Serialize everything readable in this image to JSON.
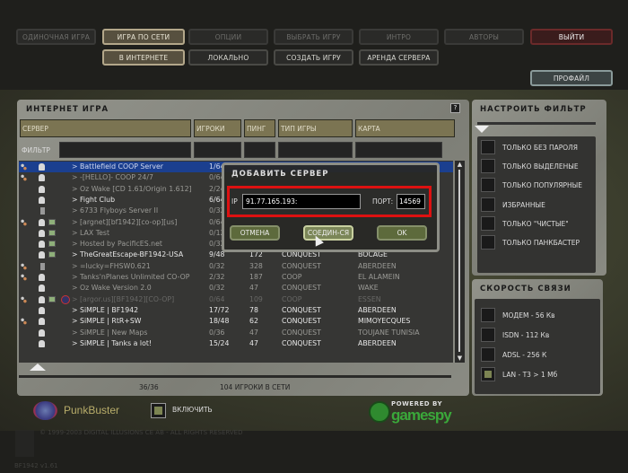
{
  "nav": {
    "main": [
      "ОДИНОЧНАЯ ИГРА",
      "ИГРА ПО СЕТИ",
      "ОПЦИИ",
      "ВЫБРАТЬ ИГРУ",
      "ИНТРО",
      "АВТОРЫ",
      "ВЫЙТИ"
    ],
    "sub": [
      "В ИНТЕРНЕТЕ",
      "ЛОКАЛЬНО",
      "СОЗДАТЬ ИГРУ",
      "АРЕНДА СЕРВЕРА"
    ],
    "profile": "ПРОФАЙЛ"
  },
  "browser": {
    "title": "ИНТЕРНЕТ ИГРА",
    "help": "?",
    "columns": [
      "СЕРВЕР",
      "ИГРОКИ",
      "ПИНГ",
      "ТИП ИГРЫ",
      "КАРТА"
    ],
    "filter_label": "ФИЛЬТР",
    "rows": [
      {
        "name": "> Battlefield COOP Server",
        "players": "1/64",
        "ping": "",
        "type": "",
        "map": ""
      },
      {
        "name": "> -[HELLO]- COOP 24/7",
        "players": "0/64",
        "ping": "",
        "type": "",
        "map": ""
      },
      {
        "name": "> Oz Wake [CD 1.61/Origin 1.612]",
        "players": "2/24",
        "ping": "",
        "type": "",
        "map": ""
      },
      {
        "name": "> Fight Club",
        "players": "6/64",
        "ping": "",
        "type": "",
        "map": ""
      },
      {
        "name": "> 6733 Flyboys Server II",
        "players": "0/32",
        "ping": "",
        "type": "",
        "map": ""
      },
      {
        "name": "> [argnet][bf1942][co-op][us]",
        "players": "0/64",
        "ping": "",
        "type": "",
        "map": ""
      },
      {
        "name": "> LAX Test",
        "players": "0/12",
        "ping": "",
        "type": "",
        "map": ""
      },
      {
        "name": "> Hosted by PacificES.net",
        "players": "0/32",
        "ping": "",
        "type": "",
        "map": ""
      },
      {
        "name": "> TheGreatEscape-BF1942-USA",
        "players": "9/48",
        "ping": "172",
        "type": "CONQUEST",
        "map": "BOCAGE"
      },
      {
        "name": "> =lucky=FHSW0.621",
        "players": "0/32",
        "ping": "328",
        "type": "CONQUEST",
        "map": "ABERDEEN"
      },
      {
        "name": "> Tanks'nPlanes Unlimited CO-OP",
        "players": "2/32",
        "ping": "187",
        "type": "COOP",
        "map": "EL ALAMEIN"
      },
      {
        "name": "> Oz Wake Version 2.0",
        "players": "0/32",
        "ping": "47",
        "type": "CONQUEST",
        "map": "WAKE"
      },
      {
        "name": "> [argor.us][BF1942][CO-OP]",
        "players": "0/64",
        "ping": "109",
        "type": "COOP",
        "map": "ESSEN"
      },
      {
        "name": "> SiMPLE | BF1942",
        "players": "17/72",
        "ping": "78",
        "type": "CONQUEST",
        "map": "ABERDEEN"
      },
      {
        "name": "> SiMPLE | RtR+SW",
        "players": "18/48",
        "ping": "62",
        "type": "CONQUEST",
        "map": "MIMOYECQUES"
      },
      {
        "name": "> SiMPLE | New Maps",
        "players": "0/36",
        "ping": "47",
        "type": "CONQUEST",
        "map": "TOUJANE TUNISIA"
      },
      {
        "name": "> SiMPLE | Tanks a lot!",
        "players": "15/24",
        "ping": "47",
        "type": "CONQUEST",
        "map": "ABERDEEN"
      }
    ],
    "count": "36/36",
    "online": "104  ИГРОКИ В СЕТИ"
  },
  "dialog": {
    "title": "ДОБАВИТЬ СЕРВЕР",
    "ip_label": "IP",
    "ip_value": "91.77.165.193:",
    "port_label": "ПОРТ:",
    "port_value": "14569",
    "cancel": "ОТМЕНА",
    "connect": "СОЕДИН-СЯ",
    "ok": "OK"
  },
  "filter": {
    "title": "НАСТРОИТЬ ФИЛЬТР",
    "options": [
      "ТОЛЬКО БЕЗ ПАРОЛЯ",
      "ТОЛЬКО ВЫДЕЛЕНЫЕ",
      "ТОЛЬКО ПОПУЛЯРНЫЕ",
      "ИЗБРАННЫЕ",
      "ТОЛЬКО \"ЧИСТЫЕ\"",
      "ТОЛЬКО ПАНКБАСТЕР"
    ]
  },
  "speed": {
    "title": "СКОРОСТЬ СВЯЗИ",
    "options": [
      "МОДЕМ - 56 Кв",
      "ISDN - 112 Кв",
      "ADSL - 256 К",
      "LAN - T3 > 1 Мб"
    ],
    "checked": 3
  },
  "footer": {
    "punkbuster": "PunkBuster",
    "enable": "ВКЛЮЧИТЬ",
    "powered": "POWERED BY",
    "gamespy": "gamespy",
    "copyright": "© 1999-2003 DIGITAL ILLUSIONS CE AB - ALL RIGHTS RESERVED",
    "version": "BF1942 v1.61"
  }
}
